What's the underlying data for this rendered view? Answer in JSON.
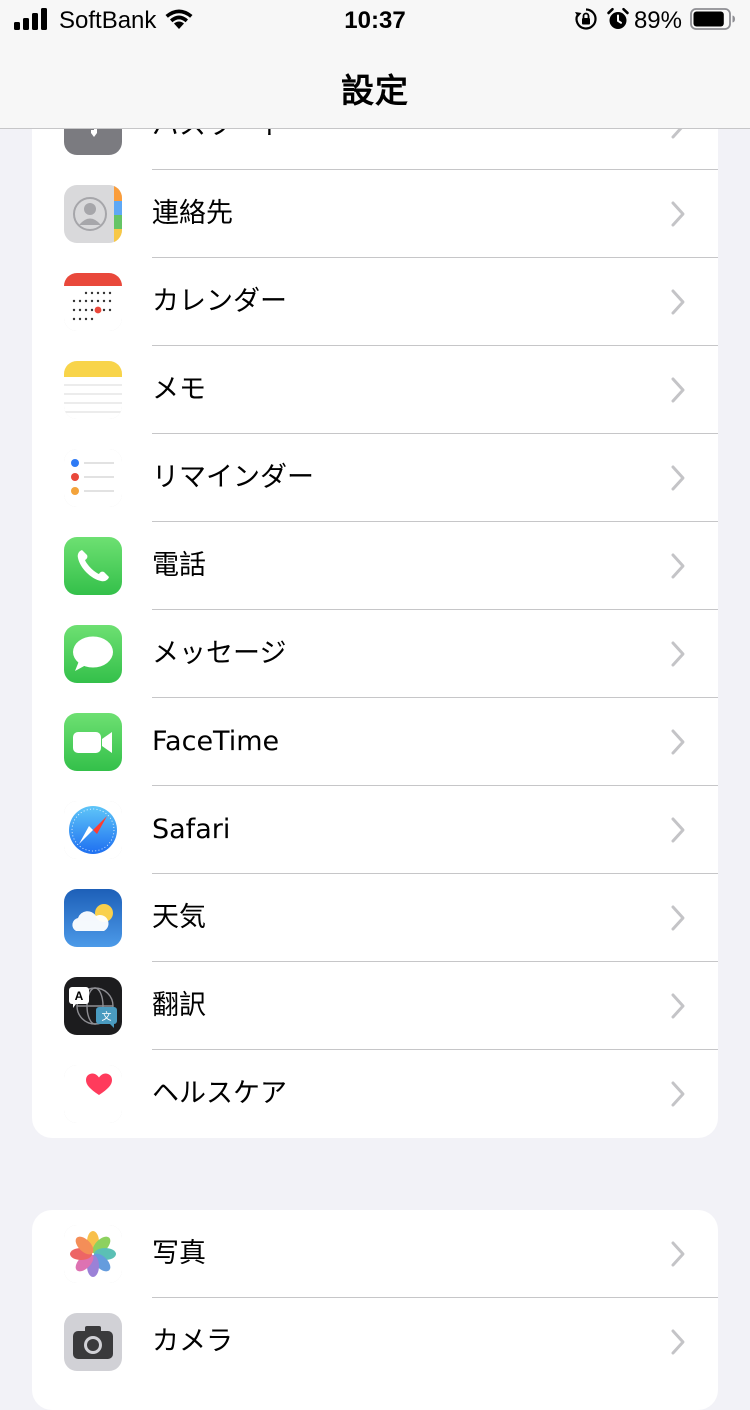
{
  "status_bar": {
    "carrier": "SoftBank",
    "time": "10:37",
    "battery_percent": "89%",
    "battery_level": 0.89,
    "icons": [
      "signal-icon",
      "wifi-icon",
      "orientation-lock-icon",
      "alarm-icon",
      "battery-icon"
    ]
  },
  "nav": {
    "title": "設定"
  },
  "group1": {
    "items": [
      {
        "label": "パスワード",
        "icon": "password-key-icon"
      },
      {
        "label": "連絡先",
        "icon": "contacts-icon"
      },
      {
        "label": "カレンダー",
        "icon": "calendar-icon"
      },
      {
        "label": "メモ",
        "icon": "notes-icon"
      },
      {
        "label": "リマインダー",
        "icon": "reminders-icon"
      },
      {
        "label": "電話",
        "icon": "phone-icon"
      },
      {
        "label": "メッセージ",
        "icon": "messages-icon"
      },
      {
        "label": "FaceTime",
        "icon": "facetime-icon"
      },
      {
        "label": "Safari",
        "icon": "safari-icon"
      },
      {
        "label": "天気",
        "icon": "weather-icon"
      },
      {
        "label": "翻訳",
        "icon": "translate-icon"
      },
      {
        "label": "ヘルスケア",
        "icon": "health-icon"
      }
    ]
  },
  "group2": {
    "items": [
      {
        "label": "写真",
        "icon": "photos-icon"
      },
      {
        "label": "カメラ",
        "icon": "camera-icon"
      }
    ]
  },
  "colors": {
    "background": "#f2f2f7",
    "separator": "#c6c6c8",
    "chevron": "#c4c4c7"
  }
}
